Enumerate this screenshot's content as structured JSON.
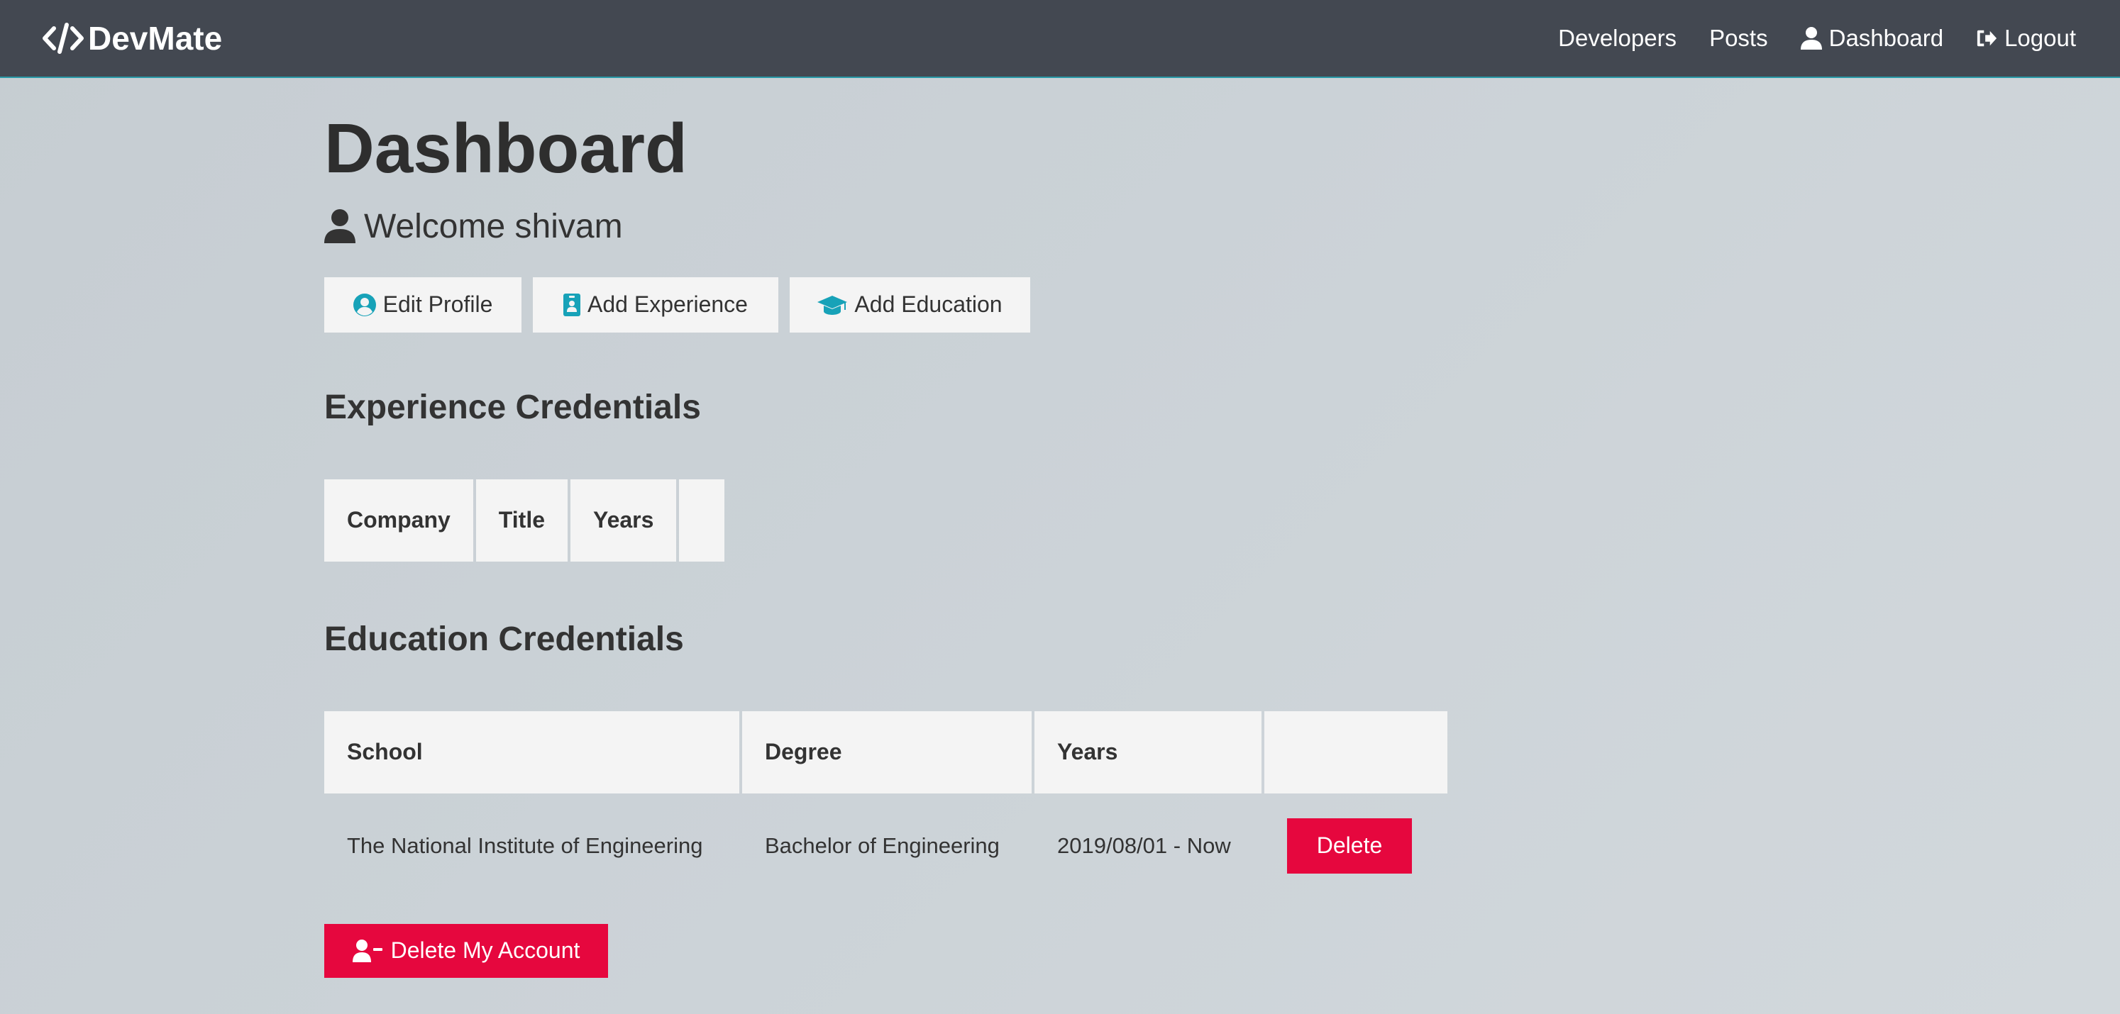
{
  "navbar": {
    "brand": "DevMate",
    "links": [
      "Developers",
      "Posts",
      "Dashboard",
      "Logout"
    ]
  },
  "main": {
    "title": "Dashboard",
    "welcome": "Welcome shivam",
    "actions": {
      "edit_profile": "Edit Profile",
      "add_experience": "Add Experience",
      "add_education": "Add Education"
    },
    "experience": {
      "title": "Experience Credentials",
      "headers": [
        "Company",
        "Title",
        "Years",
        ""
      ]
    },
    "education": {
      "title": "Education Credentials",
      "headers": [
        "School",
        "Degree",
        "Years",
        ""
      ],
      "rows": [
        {
          "school": "The National Institute of Engineering",
          "degree": "Bachelor of Engineering",
          "years": "2019/08/01 - Now",
          "delete_label": "Delete"
        }
      ]
    },
    "delete_account": "Delete My Account"
  },
  "colors": {
    "navbar": "#434851",
    "accent": "#17a2b8",
    "danger": "#e6073e",
    "light": "#f4f4f4"
  },
  "icons": {
    "brand": "code-icon",
    "dashboard": "user-icon",
    "logout": "sign-out-icon",
    "welcome": "user-icon",
    "edit_profile": "user-circle-icon",
    "add_experience": "id-badge-icon",
    "add_education": "graduation-cap-icon",
    "delete_account": "user-minus-icon"
  }
}
